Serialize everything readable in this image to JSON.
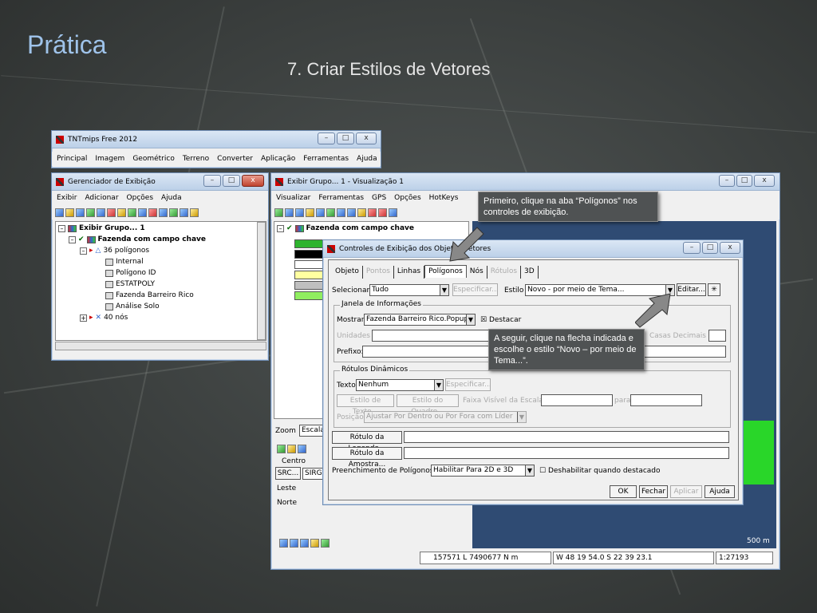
{
  "slide": {
    "title": "Prática",
    "subtitle": "7. Criar Estilos de Vetores"
  },
  "main_window": {
    "title": "TNTmips Free 2012",
    "menu": [
      "Principal",
      "Imagem",
      "Geométrico",
      "Terreno",
      "Converter",
      "Aplicação",
      "Ferramentas",
      "Ajuda"
    ]
  },
  "display_manager": {
    "title": "Gerenciador de Exibição",
    "menu": [
      "Exibir",
      "Adicionar",
      "Opções",
      "Ajuda"
    ],
    "tree": {
      "group": "Exibir Grupo... 1",
      "layer": "Fazenda com campo chave",
      "polygons": "36 polígonos",
      "items": [
        "Internal",
        "Polígono ID",
        "ESTATPOLY",
        "Fazenda Barreiro Rico",
        "Análise Solo"
      ],
      "nodes": "40 nós"
    }
  },
  "view_window": {
    "title": "Exibir Grupo... 1 - Visualização 1",
    "menu": [
      "Visualizar",
      "Ferramentas",
      "GPS",
      "Opções",
      "HotKeys"
    ],
    "legend_layer": "Fazenda com campo chave",
    "legend_colors": [
      "#2db32d",
      "#000000",
      "#ffffff",
      "#ffffa0",
      "#bfbfbf",
      "#90ee60"
    ],
    "side": {
      "zoom": "Zoom",
      "escala": "Escala",
      "centro": "Centro",
      "src": "SRC...",
      "sirg": "SIRG",
      "leste": "Leste",
      "norte": "Norte"
    },
    "status": {
      "coords": "157571 L 7490677 N m",
      "latlon": "W 48 19 54.0  S 22 39 23.1",
      "scale": "1:27193",
      "scalebar": "500 m"
    }
  },
  "dialog": {
    "title": "Controles de Exibição dos Objetos Vetores",
    "tabs": [
      "Objeto",
      "Pontos",
      "Linhas",
      "Polígonos",
      "Nós",
      "Rótulos",
      "3D"
    ],
    "selecionar_label": "Selecionar",
    "selecionar_value": "Tudo",
    "especificar": "Especificar...",
    "estilo_label": "Estilo",
    "estilo_value": "Novo - por meio de Tema...",
    "editar": "Editar...",
    "janela_info": "Janela de Informações",
    "mostrar_label": "Mostrar",
    "mostrar_value": "Fazenda Barreiro Rico.Popup",
    "destacar": "Destacar",
    "unidades": "Unidades",
    "casas": "Casas Decimais",
    "prefixo": "Prefixo:",
    "rotulos_din": "Rótulos Dinâmicos",
    "texto_label": "Texto",
    "texto_value": "Nenhum",
    "estilo_texto": "Estilo de Texto...",
    "estilo_quadro": "Estilo do Quadro...",
    "faixa": "Faixa Visível da Escala",
    "para": "para",
    "posicao": "Posição",
    "posicao_value": "Ajustar Por Dentro ou Por Fora com Líder",
    "rotulo_legenda": "Rótulo da Legenda...",
    "rotulo_amostra": "Rótulo da Amostra...",
    "preench_label": "Preenchimento de Polígonos",
    "preench_value": "Habilitar Para 2D e 3D",
    "desabilitar": "Deshabilitar quando destacado",
    "ok": "OK",
    "fechar": "Fechar",
    "aplicar": "Aplicar",
    "ajuda": "Ajuda"
  },
  "callouts": {
    "first": "Primeiro, clique na aba “Polígonos” nos controles de exibição.",
    "second": "A seguir, clique na flecha indicada e escolhe o estilo “Novo – por meio de Tema...”."
  }
}
